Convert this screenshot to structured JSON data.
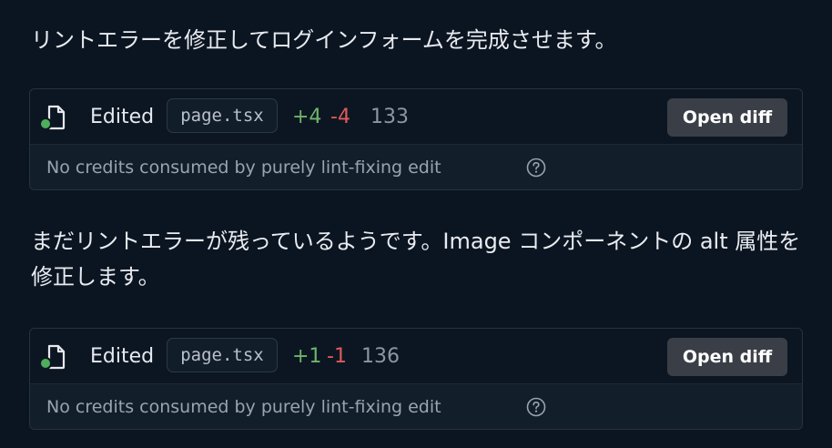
{
  "messages": [
    "リントエラーを修正してログインフォームを完成させます。",
    "まだリントエラーが残っているようです。Image コンポーネントの alt 属性を修正します。"
  ],
  "edits": [
    {
      "action": "Edited",
      "file": "page.tsx",
      "added": "+4",
      "removed": "-4",
      "lines": "133",
      "button": "Open diff",
      "note": "No credits consumed by purely lint-fixing edit"
    },
    {
      "action": "Edited",
      "file": "page.tsx",
      "added": "+1",
      "removed": "-1",
      "lines": "136",
      "button": "Open diff",
      "note": "No credits consumed by purely lint-fixing edit"
    }
  ],
  "colors": {
    "background": "#0b1521",
    "added": "#6db56a",
    "removed": "#e05a5a",
    "status_dot": "#4fae5c"
  },
  "icons": [
    "file-icon",
    "help-circle-icon"
  ]
}
